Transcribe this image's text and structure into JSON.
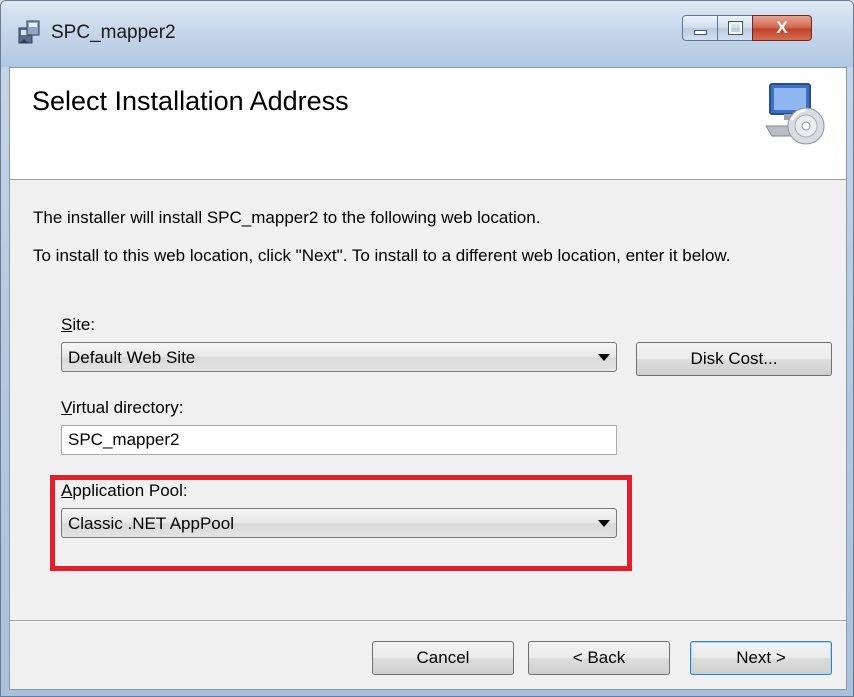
{
  "window": {
    "title": "SPC_mapper2",
    "close_glyph": "X"
  },
  "banner": {
    "title": "Select Installation Address",
    "icon": "computer-with-disc-icon"
  },
  "body": {
    "line1": "The installer will install SPC_mapper2 to the following web location.",
    "line2": "To install to this web location, click \"Next\". To install to a different web location, enter it below."
  },
  "site": {
    "label_key": "S",
    "label_rest": "ite:",
    "selected": "Default Web Site"
  },
  "disk_cost_label": "Disk Cost...",
  "virtual_directory": {
    "label_key": "V",
    "label_rest": "irtual directory:",
    "value": "SPC_mapper2"
  },
  "app_pool": {
    "label_key": "A",
    "label_rest": "pplication Pool:",
    "selected": "Classic .NET AppPool"
  },
  "buttons": {
    "cancel": "Cancel",
    "back": "< Back",
    "next": "Next >"
  },
  "colors": {
    "highlight": "#e0202c",
    "dialog_bg": "#f0f0f0",
    "banner_bg": "#ffffff"
  }
}
